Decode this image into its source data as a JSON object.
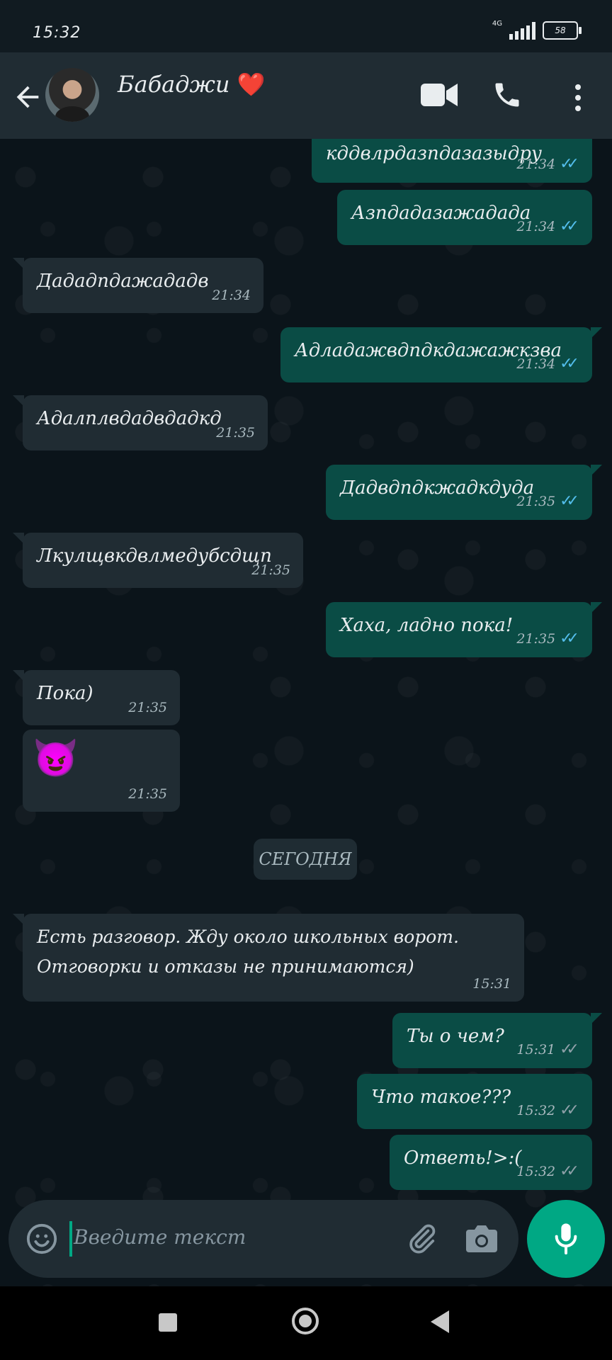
{
  "status_bar": {
    "time": "15:32",
    "network": "4G",
    "battery": "58"
  },
  "header": {
    "contact_name": "Бабаджи",
    "heart": "❤️"
  },
  "messages": [
    {
      "text": "кддвлрдазпдазазыдру",
      "time": "21:34"
    },
    {
      "text": "Азпдадазажадада",
      "time": "21:34"
    },
    {
      "text": "Дададпдажададв",
      "time": "21:34"
    },
    {
      "text": "Адладажвдпдкдажажкзва",
      "time": "21:34"
    },
    {
      "text": "Адалплвдадвдадкд",
      "time": "21:35"
    },
    {
      "text": "Дадвдпдкжадкдуда",
      "time": "21:35"
    },
    {
      "text": "Лкулщвкдвлмедубсдщп",
      "time": "21:35"
    },
    {
      "text": "Хаха, ладно пока!",
      "time": "21:35"
    },
    {
      "text": "Пока)",
      "time": "21:35"
    },
    {
      "text": "😈",
      "time": "21:35"
    },
    {
      "text": "Есть разговор. Жду около школьных ворот. Отговорки и отказы не принимаются)",
      "time": "15:31"
    },
    {
      "text": "Ты о чем?",
      "time": "15:31"
    },
    {
      "text": "Что такое???",
      "time": "15:32"
    },
    {
      "text": "Ответь!>:(",
      "time": "15:32"
    }
  ],
  "date_divider": "СЕГОДНЯ",
  "compose": {
    "placeholder": "Введите текст"
  },
  "colors": {
    "accent": "#00a884",
    "read_tick": "#53bdeb",
    "outgoing_bubble": "#0a4c45",
    "incoming_bubble": "#202c33"
  }
}
